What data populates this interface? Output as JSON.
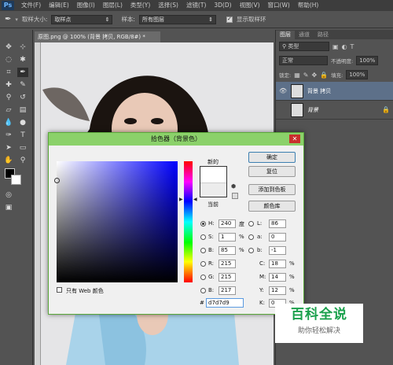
{
  "app": {
    "logo": "Ps"
  },
  "menu": [
    "文件(F)",
    "编辑(E)",
    "图像(I)",
    "图层(L)",
    "类型(Y)",
    "选择(S)",
    "滤镜(T)",
    "3D(D)",
    "视图(V)",
    "窗口(W)",
    "帮助(H)"
  ],
  "options": {
    "sample_size_label": "取样大小:",
    "sample_size_value": "取样点",
    "sample_label": "样本:",
    "sample_value": "所有图层",
    "show_ring_label": "显示取样环"
  },
  "document": {
    "tab_title": "原图.png @ 100% (背景 拷贝, RGB/8#) *"
  },
  "panels": {
    "tabs": [
      "图层",
      "通道",
      "路径"
    ],
    "kind": "类型",
    "blend": "正常",
    "opacity_label": "不透明度:",
    "opacity": "100%",
    "lock_label": "锁定:",
    "fill_label": "填充:",
    "fill": "100%",
    "layers": [
      {
        "name": "背景 拷贝",
        "selected": true
      },
      {
        "name": "背景",
        "selected": false
      }
    ]
  },
  "color_picker": {
    "title": "拾色器（背景色）",
    "new_label": "新的",
    "current_label": "当前",
    "ok": "确定",
    "reset": "复位",
    "add_swatch": "添加到色板",
    "libraries": "颜色库",
    "h": "240",
    "h_unit": "度",
    "s": "1",
    "s_unit": "%",
    "b": "85",
    "b_unit": "%",
    "r": "215",
    "g": "215",
    "b_rgb": "217",
    "l": "86",
    "a": "0",
    "b_lab": "-1",
    "c": "18",
    "m": "14",
    "y": "12",
    "k": "0",
    "percent": "%",
    "hex": "d7d7d9",
    "web_only": "只有 Web 颜色",
    "new_color": "#ffffff",
    "current_color": "#ececec"
  },
  "watermark": {
    "title": "百科全说",
    "subtitle": "助你轻松解决"
  }
}
